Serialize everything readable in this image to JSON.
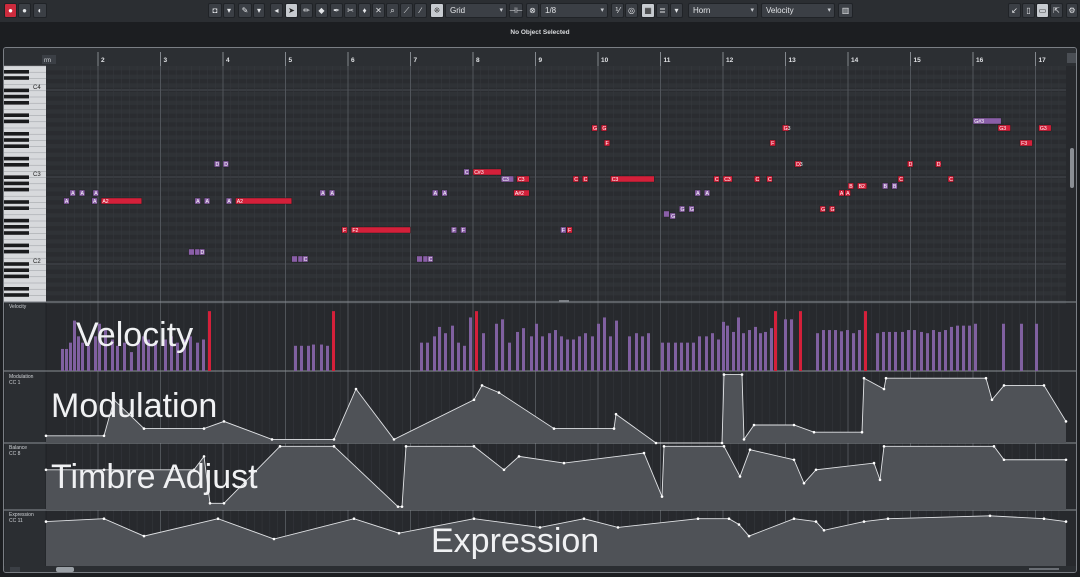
{
  "toolbar": {
    "snap_mode": "Grid",
    "quantize": "1/8",
    "instrument": "Horn",
    "controller": "Velocity"
  },
  "status": "No Object Selected",
  "ruler": {
    "first_label": "rm",
    "bars": [
      "2",
      "3",
      "4",
      "5",
      "6",
      "7",
      "8",
      "9",
      "10",
      "11",
      "12",
      "13",
      "14",
      "15",
      "16",
      "17"
    ]
  },
  "keyboard": {
    "labels": [
      "C4",
      "C3",
      "C2"
    ]
  },
  "notes": [
    {
      "bar": 3.86,
      "len": 0.09,
      "pitch": "D",
      "label": "D",
      "row": "D3",
      "color": "violet"
    },
    {
      "bar": 4.0,
      "len": 0.09,
      "pitch": "D",
      "label": "D",
      "row": "D3",
      "color": "violet"
    },
    {
      "bar": 1.55,
      "len": 0.09,
      "label": "A",
      "row": "A2",
      "color": "violet"
    },
    {
      "bar": 1.7,
      "len": 0.09,
      "label": "A",
      "row": "A2",
      "color": "violet"
    },
    {
      "bar": 1.92,
      "len": 0.09,
      "label": "A",
      "row": "A2",
      "color": "violet"
    },
    {
      "bar": 1.45,
      "len": 0.09,
      "label": "A",
      "row": "A2lo",
      "color": "violet"
    },
    {
      "bar": 1.9,
      "len": 0.09,
      "label": "A",
      "row": "A2lo",
      "color": "violet"
    },
    {
      "bar": 2.05,
      "len": 0.65,
      "label": "A2",
      "row": "A2lo",
      "color": "red"
    },
    {
      "bar": 3.55,
      "len": 0.09,
      "label": "A",
      "row": "A2lo",
      "color": "violet"
    },
    {
      "bar": 3.7,
      "len": 0.09,
      "label": "A",
      "row": "A2lo",
      "color": "violet"
    },
    {
      "bar": 4.05,
      "len": 0.09,
      "label": "A",
      "row": "A2lo",
      "color": "violet"
    },
    {
      "bar": 4.2,
      "len": 0.9,
      "label": "A2",
      "row": "A2lo",
      "color": "red"
    },
    {
      "bar": 3.45,
      "len": 0.09,
      "label": "",
      "row": "D2",
      "color": "violet"
    },
    {
      "bar": 3.55,
      "len": 0.09,
      "label": "",
      "row": "D2",
      "color": "violet"
    },
    {
      "bar": 3.62,
      "len": 0.09,
      "label": "D",
      "row": "D2",
      "color": "violet"
    },
    {
      "bar": 5.1,
      "len": 0.09,
      "label": "",
      "row": "C2",
      "color": "violet"
    },
    {
      "bar": 5.2,
      "len": 0.09,
      "label": "",
      "row": "C2",
      "color": "violet"
    },
    {
      "bar": 5.27,
      "len": 0.09,
      "label": "C",
      "row": "C2",
      "color": "violet"
    },
    {
      "bar": 5.55,
      "len": 0.09,
      "label": "A",
      "row": "A2",
      "color": "violet"
    },
    {
      "bar": 5.7,
      "len": 0.09,
      "label": "A",
      "row": "A2",
      "color": "violet"
    },
    {
      "bar": 5.9,
      "len": 0.09,
      "label": "F",
      "row": "F2",
      "color": "red"
    },
    {
      "bar": 6.05,
      "len": 0.95,
      "label": "F2",
      "row": "F2",
      "color": "red"
    },
    {
      "bar": 7.1,
      "len": 0.09,
      "label": "",
      "row": "C2",
      "color": "violet"
    },
    {
      "bar": 7.2,
      "len": 0.09,
      "label": "",
      "row": "C2",
      "color": "violet"
    },
    {
      "bar": 7.27,
      "len": 0.09,
      "label": "C",
      "row": "C2",
      "color": "violet"
    },
    {
      "bar": 7.35,
      "len": 0.09,
      "label": "A",
      "row": "A2",
      "color": "violet"
    },
    {
      "bar": 7.5,
      "len": 0.09,
      "label": "A",
      "row": "A2",
      "color": "violet"
    },
    {
      "bar": 7.65,
      "len": 0.09,
      "label": "F",
      "row": "F2",
      "color": "violet"
    },
    {
      "bar": 7.8,
      "len": 0.09,
      "label": "F",
      "row": "F2",
      "color": "violet"
    },
    {
      "bar": 7.85,
      "len": 0.09,
      "label": "C",
      "row": "C#3",
      "color": "violet"
    },
    {
      "bar": 8.0,
      "len": 0.45,
      "label": "C#3",
      "row": "C#3",
      "color": "red"
    },
    {
      "bar": 8.45,
      "len": 0.2,
      "label": "C3",
      "row": "C3",
      "color": "violet"
    },
    {
      "bar": 8.7,
      "len": 0.2,
      "label": "C3",
      "row": "C3",
      "color": "red"
    },
    {
      "bar": 8.65,
      "len": 0.25,
      "label": "A#2",
      "row": "A2",
      "color": "red"
    },
    {
      "bar": 9.4,
      "len": 0.09,
      "label": "F",
      "row": "F2",
      "color": "violet"
    },
    {
      "bar": 9.5,
      "len": 0.09,
      "label": "F",
      "row": "F2",
      "color": "red"
    },
    {
      "bar": 9.6,
      "len": 0.09,
      "label": "C",
      "row": "C3",
      "color": "red"
    },
    {
      "bar": 9.75,
      "len": 0.09,
      "label": "C",
      "row": "C3",
      "color": "red"
    },
    {
      "bar": 9.9,
      "len": 0.09,
      "label": "G",
      "row": "G3",
      "color": "red"
    },
    {
      "bar": 10.05,
      "len": 0.09,
      "label": "G",
      "row": "G3",
      "color": "red"
    },
    {
      "bar": 10.1,
      "len": 0.09,
      "label": "F",
      "row": "F3",
      "color": "red"
    },
    {
      "bar": 10.2,
      "len": 0.7,
      "label": "C3",
      "row": "C3",
      "color": "red"
    },
    {
      "bar": 11.05,
      "len": 0.09,
      "label": "",
      "row": "F2hi",
      "color": "violet"
    },
    {
      "bar": 11.15,
      "len": 0.09,
      "label": "G",
      "row": "G2lo",
      "color": "violet"
    },
    {
      "bar": 11.3,
      "len": 0.09,
      "label": "G",
      "row": "G2",
      "color": "violet"
    },
    {
      "bar": 11.45,
      "len": 0.09,
      "label": "G",
      "row": "G2",
      "color": "violet"
    },
    {
      "bar": 11.55,
      "len": 0.09,
      "label": "A",
      "row": "A2",
      "color": "violet"
    },
    {
      "bar": 11.7,
      "len": 0.09,
      "label": "A",
      "row": "A2",
      "color": "violet"
    },
    {
      "bar": 11.85,
      "len": 0.09,
      "label": "C",
      "row": "C3",
      "color": "red"
    },
    {
      "bar": 12.0,
      "len": 0.15,
      "label": "C3",
      "row": "C3",
      "color": "red"
    },
    {
      "bar": 12.5,
      "len": 0.09,
      "label": "C",
      "row": "C3",
      "color": "red"
    },
    {
      "bar": 12.7,
      "len": 0.09,
      "label": "C",
      "row": "C3",
      "color": "red"
    },
    {
      "bar": 12.75,
      "len": 0.09,
      "label": "F",
      "row": "F3",
      "color": "red"
    },
    {
      "bar": 12.95,
      "len": 0.1,
      "label": "G3",
      "row": "G3",
      "color": "red"
    },
    {
      "bar": 13.15,
      "len": 0.1,
      "label": "D3",
      "row": "D3",
      "color": "red"
    },
    {
      "bar": 13.55,
      "len": 0.09,
      "label": "G",
      "row": "G2",
      "color": "red"
    },
    {
      "bar": 13.7,
      "len": 0.09,
      "label": "G",
      "row": "G2",
      "color": "red"
    },
    {
      "bar": 13.85,
      "len": 0.09,
      "label": "A",
      "row": "A2",
      "color": "red"
    },
    {
      "bar": 13.95,
      "len": 0.09,
      "label": "A",
      "row": "A2",
      "color": "red"
    },
    {
      "bar": 14.0,
      "len": 0.09,
      "label": "B",
      "row": "B2",
      "color": "red"
    },
    {
      "bar": 14.15,
      "len": 0.15,
      "label": "B2",
      "row": "B2",
      "color": "red"
    },
    {
      "bar": 14.55,
      "len": 0.09,
      "label": "B",
      "row": "B2",
      "color": "violet"
    },
    {
      "bar": 14.7,
      "len": 0.09,
      "label": "B",
      "row": "B2",
      "color": "violet"
    },
    {
      "bar": 14.8,
      "len": 0.09,
      "label": "C",
      "row": "C3",
      "color": "red"
    },
    {
      "bar": 14.95,
      "len": 0.09,
      "label": "D",
      "row": "D3",
      "color": "red"
    },
    {
      "bar": 15.4,
      "len": 0.09,
      "label": "D",
      "row": "D3",
      "color": "red"
    },
    {
      "bar": 15.6,
      "len": 0.09,
      "label": "C",
      "row": "C3",
      "color": "red"
    },
    {
      "bar": 16.0,
      "len": 0.45,
      "label": "G#3",
      "row": "G#3",
      "color": "violet"
    },
    {
      "bar": 16.4,
      "len": 0.2,
      "label": "G3",
      "row": "G3",
      "color": "red"
    },
    {
      "bar": 16.75,
      "len": 0.2,
      "label": "F3",
      "row": "F3",
      "color": "red"
    },
    {
      "bar": 17.05,
      "len": 0.2,
      "label": "G3",
      "row": "G3",
      "color": "red"
    }
  ],
  "lanes": [
    {
      "name": "Velocity",
      "sub": "",
      "big": "Velocity"
    },
    {
      "name": "Modulation",
      "sub": "CC 1",
      "big": "Modulation"
    },
    {
      "name": "Balance",
      "sub": "CC 8",
      "big": "Timbre Adjust"
    },
    {
      "name": "Expression",
      "sub": "CC 11",
      "big": "Expression"
    }
  ],
  "colors": {
    "accent_red": "#cc2b3d",
    "note_violet": "#8a5fa8",
    "note_red": "#d4203a",
    "lane_fill": "#5a5d62"
  }
}
